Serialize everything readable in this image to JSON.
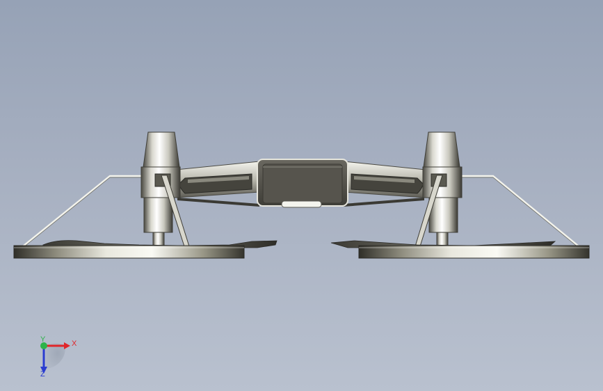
{
  "viewport": {
    "background_top": "#96a2b6",
    "background_bottom": "#b9c1cf"
  },
  "model": {
    "parts": [
      "left-wheel-disc",
      "right-wheel-disc",
      "left-motor-pod",
      "right-motor-pod",
      "left-arm",
      "right-arm",
      "center-body",
      "left-strut",
      "right-strut",
      "left-wire-support",
      "right-wire-support",
      "left-blade",
      "right-blade"
    ],
    "colors": {
      "metal_light": "#f2f2ea",
      "metal_dark": "#3e3d36",
      "body_dark": "#5a5850"
    }
  },
  "triad": {
    "x_label": "X",
    "y_label": "Y",
    "z_label": "Z",
    "x_color": "#e0262a",
    "y_color": "#2eb34a",
    "z_color": "#2a3cd0"
  }
}
